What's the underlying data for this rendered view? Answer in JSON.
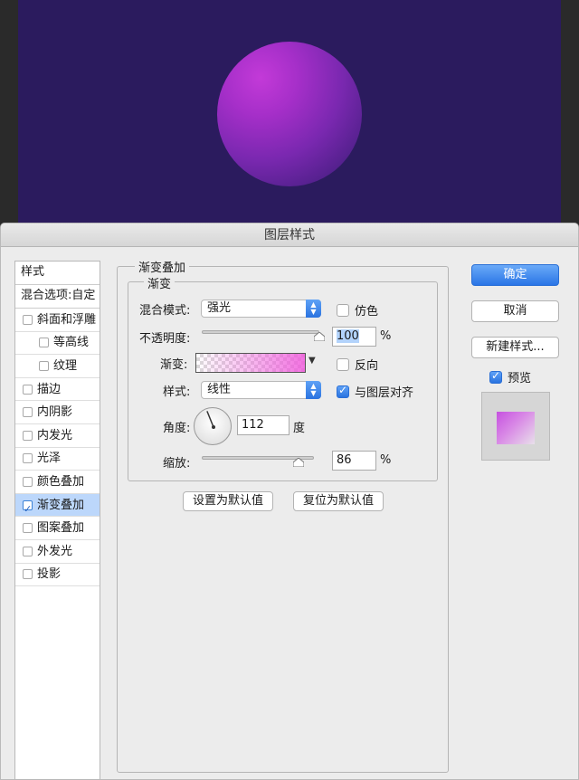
{
  "dialog": {
    "title": "图层样式"
  },
  "sidebar": {
    "header": "样式",
    "blend_options": "混合选项:自定",
    "items": [
      {
        "label": "斜面和浮雕",
        "checked": false,
        "sub": false,
        "selected": false
      },
      {
        "label": "等高线",
        "checked": false,
        "sub": true,
        "selected": false
      },
      {
        "label": "纹理",
        "checked": false,
        "sub": true,
        "selected": false
      },
      {
        "label": "描边",
        "checked": false,
        "sub": false,
        "selected": false
      },
      {
        "label": "内阴影",
        "checked": false,
        "sub": false,
        "selected": false
      },
      {
        "label": "内发光",
        "checked": false,
        "sub": false,
        "selected": false
      },
      {
        "label": "光泽",
        "checked": false,
        "sub": false,
        "selected": false
      },
      {
        "label": "颜色叠加",
        "checked": false,
        "sub": false,
        "selected": false
      },
      {
        "label": "渐变叠加",
        "checked": true,
        "sub": false,
        "selected": true
      },
      {
        "label": "图案叠加",
        "checked": false,
        "sub": false,
        "selected": false
      },
      {
        "label": "外发光",
        "checked": false,
        "sub": false,
        "selected": false
      },
      {
        "label": "投影",
        "checked": false,
        "sub": false,
        "selected": false
      }
    ]
  },
  "panel": {
    "group_title": "渐变叠加",
    "inner_title": "渐变",
    "blend_mode_label": "混合模式:",
    "blend_mode_value": "强光",
    "dither_label": "仿色",
    "dither_checked": false,
    "opacity_label": "不透明度:",
    "opacity_value": "100",
    "opacity_unit": "%",
    "opacity_level": 1.0,
    "gradient_label": "渐变:",
    "reverse_label": "反向",
    "reverse_checked": false,
    "style_label": "样式:",
    "style_value": "线性",
    "align_label": "与图层对齐",
    "align_checked": true,
    "angle_label": "角度:",
    "angle_value": "112",
    "angle_unit": "度",
    "scale_label": "缩放:",
    "scale_value": "86",
    "scale_unit": "%",
    "scale_level": 0.86,
    "make_default": "设置为默认值",
    "reset_default": "复位为默认值"
  },
  "buttons": {
    "ok": "确定",
    "cancel": "取消",
    "new_style": "新建样式...",
    "preview_label": "预览",
    "preview_checked": true
  },
  "colors": {
    "canvas_bg": "#2b1b5e",
    "ball": "#a62fc9",
    "accent": "#2a75e6"
  }
}
